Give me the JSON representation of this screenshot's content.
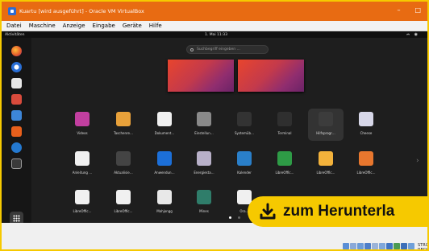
{
  "window": {
    "title": "Kuartu [wird ausgeführt] - Oracle VM VirtualBox",
    "minimize": "–",
    "maximize": "□"
  },
  "menubar": [
    "Datei",
    "Maschine",
    "Anzeige",
    "Eingabe",
    "Geräte",
    "Hilfe"
  ],
  "guest_topbar": {
    "activities": "Aktivitäten",
    "clock": "1. Mai 11:33",
    "status_icons": "ሐ ◉"
  },
  "search": {
    "placeholder": "Suchbegriff eingeben …"
  },
  "apps": [
    {
      "label": "Videos",
      "color": "#c23fa0"
    },
    {
      "label": "Taschenre…",
      "color": "#e8a13a"
    },
    {
      "label": "Dokument…",
      "color": "#f0f0f0"
    },
    {
      "label": "Einstellun…",
      "color": "#8a8a8a"
    },
    {
      "label": "Systemüb…",
      "color": "#333333"
    },
    {
      "label": "Terminal",
      "color": "#2f2f2f"
    },
    {
      "label": "Hilfsprogr…",
      "color": "#3c3c3c"
    },
    {
      "label": "Cheese",
      "color": "#d7d7e8"
    },
    {
      "label": "Anleitung …",
      "color": "#f0f0f0"
    },
    {
      "label": "Aktualisie…",
      "color": "#444444"
    },
    {
      "label": "Anwendun…",
      "color": "#1c6fd8"
    },
    {
      "label": "Energiesta…",
      "color": "#b8b0c8"
    },
    {
      "label": "Kalender",
      "color": "#2a7fc9"
    },
    {
      "label": "LibreOffic…",
      "color": "#2e9b46"
    },
    {
      "label": "LibreOffic…",
      "color": "#f3b23b"
    },
    {
      "label": "LibreOffic…",
      "color": "#e8772e"
    },
    {
      "label": "LibreOffic…",
      "color": "#f0f0f0"
    },
    {
      "label": "LibreOffic…",
      "color": "#f0f0f0"
    },
    {
      "label": "Mahjongg",
      "color": "#e8e8e8"
    },
    {
      "label": "Mines",
      "color": "#2f7d6a"
    },
    {
      "label": "Ora…",
      "color": "#f0f0f0"
    }
  ],
  "statusbar": {
    "host_key": "STRG-RECHTS"
  },
  "banner": {
    "text": "zum Herunterla"
  },
  "colors": {
    "titlebar": "#e86b12",
    "frame": "#f6c900",
    "banner": "#f6c900"
  }
}
